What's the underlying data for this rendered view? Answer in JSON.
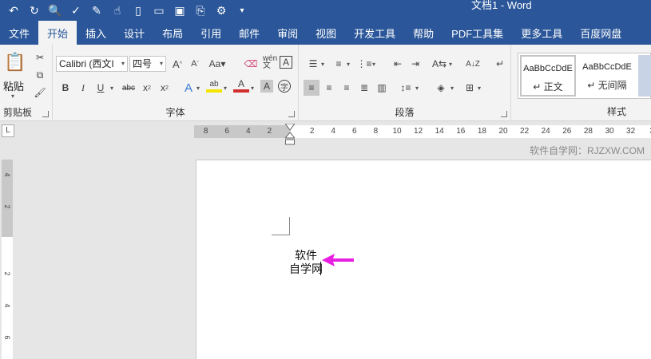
{
  "app": {
    "title": "文档1  -  Word"
  },
  "colors": {
    "accent": "#2b579a",
    "ribbon_bg": "#f3f3f3",
    "arrow": "#e81ee1",
    "font_color_red": "#d12e2e",
    "highlight_yellow": "#f5e400"
  },
  "tabs": [
    "文件",
    "开始",
    "插入",
    "设计",
    "布局",
    "引用",
    "邮件",
    "审阅",
    "视图",
    "开发工具",
    "帮助",
    "PDF工具集",
    "更多工具",
    "百度网盘"
  ],
  "active_tab": "开始",
  "clipboard": {
    "paste_label": "粘贴",
    "group_label": "剪贴板"
  },
  "font": {
    "name": "Calibri (西文I",
    "size": "四号",
    "group_label": "字体"
  },
  "paragraph": {
    "group_label": "段落"
  },
  "styles": {
    "group_label": "样式",
    "items": [
      {
        "sample": "AaBbCcDdE",
        "name": "↵ 正文"
      },
      {
        "sample": "AaBbCcDdE",
        "name": "↵ 无间隔"
      }
    ]
  },
  "ruler": {
    "corner": "L",
    "left_ticks": [
      "8",
      "6",
      "4",
      "2"
    ],
    "right_ticks": [
      "2",
      "4",
      "6",
      "8",
      "10",
      "12",
      "14",
      "16",
      "18",
      "20",
      "22",
      "24",
      "26",
      "28",
      "30",
      "32",
      "3"
    ],
    "vertical_ticks": [
      "4",
      "2",
      "2",
      "4",
      "6"
    ]
  },
  "watermark": "软件自学网：RJZXW.COM",
  "document": {
    "line1": "软件",
    "line2": "自学网"
  }
}
